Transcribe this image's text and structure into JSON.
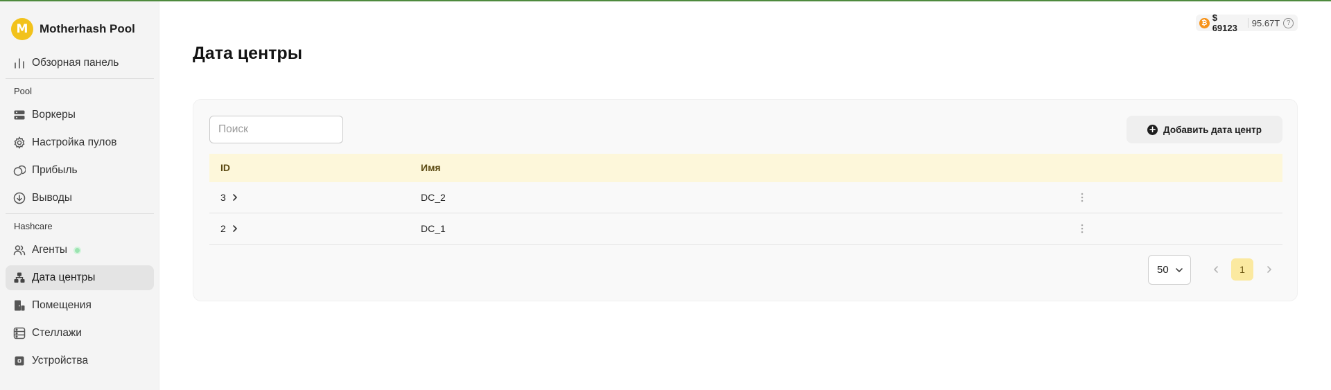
{
  "app": {
    "brand_name": "Motherhash Pool",
    "brand_logo_letter": "M"
  },
  "sidebar": {
    "dashboard": {
      "label": "Обзорная панель",
      "icon": "bar-chart-icon"
    },
    "pool_section": "Pool",
    "pool_items": [
      {
        "label": "Воркеры",
        "icon": "server-icon"
      },
      {
        "label": "Настройка пулов",
        "icon": "gear-icon"
      },
      {
        "label": "Прибыль",
        "icon": "coins-icon"
      },
      {
        "label": "Выводы",
        "icon": "download-circle-icon"
      }
    ],
    "hashcare_section": "Hashcare",
    "hashcare_items": [
      {
        "label": "Агенты",
        "icon": "users-icon",
        "status": "online"
      },
      {
        "label": "Дата центры",
        "icon": "network-icon",
        "active": true
      },
      {
        "label": "Помещения",
        "icon": "room-icon"
      },
      {
        "label": "Стеллажи",
        "icon": "rack-icon"
      },
      {
        "label": "Устройства",
        "icon": "device-icon"
      }
    ]
  },
  "ticker": {
    "price": "$ 69123",
    "hashrate": "95.67T",
    "coin_icon": "bitcoin-icon"
  },
  "page": {
    "title": "Дата центры"
  },
  "toolbar": {
    "search_placeholder": "Поиск",
    "add_label": "Добавить дата центр"
  },
  "table": {
    "columns": [
      "ID",
      "Имя"
    ],
    "rows": [
      {
        "id": "3",
        "name": "DC_2"
      },
      {
        "id": "2",
        "name": "DC_1"
      }
    ]
  },
  "pagination": {
    "page_size": "50",
    "current_page": "1"
  },
  "colors": {
    "accent": "#f2c21b",
    "header_bg": "#fdf7da",
    "active_page": "#fbe9a0",
    "online": "#9be3b0"
  }
}
